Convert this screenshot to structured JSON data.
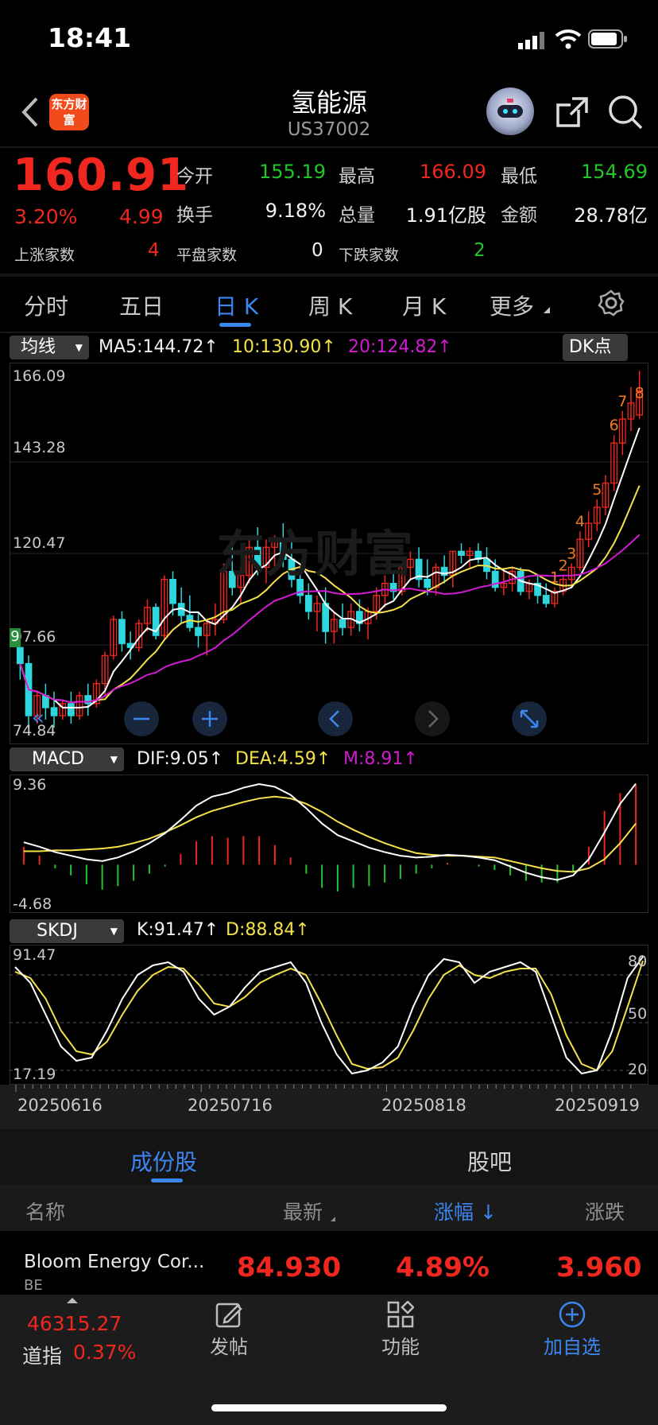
{
  "status_bar": {
    "time": "18:41"
  },
  "header": {
    "title": "氢能源",
    "code": "US37002",
    "brand": "东方财富"
  },
  "quote": {
    "price": "160.91",
    "change_pct": "3.20%",
    "change": "4.99",
    "open_label": "今开",
    "open": "155.19",
    "high_label": "最高",
    "high": "166.09",
    "low_label": "最低",
    "low": "154.69",
    "turnover_label": "换手",
    "turnover": "9.18%",
    "volume_label": "总量",
    "volume": "1.91亿股",
    "amount_label": "金额",
    "amount": "28.78亿",
    "rise_label": "上涨家数",
    "rise": "4",
    "flat_label": "平盘家数",
    "flat": "0",
    "fall_label": "下跌家数",
    "fall": "2"
  },
  "tabs": [
    "分时",
    "五日",
    "日 K",
    "周 K",
    "月 K",
    "更多"
  ],
  "active_tab": "日 K",
  "main_chart": {
    "indicator_button": "均线",
    "ma5": "MA5:144.72",
    "ma10": "10:130.90",
    "ma20": "20:124.82",
    "dk_button": "DK点",
    "y_ticks": [
      "166.09",
      "143.28",
      "120.47",
      "97.66",
      "74.84"
    ],
    "watermark": "东方财富",
    "signal_left": "9",
    "signals": [
      "1",
      "2",
      "3",
      "4",
      "5",
      "6",
      "7",
      "8"
    ]
  },
  "macd_chart": {
    "indicator_button": "MACD",
    "dif": "DIF:9.05",
    "dea": "DEA:4.59",
    "m": "M:8.91",
    "y_ticks": [
      "9.36",
      "-4.68"
    ]
  },
  "skdj_chart": {
    "indicator_button": "SKDJ",
    "k": "K:91.47",
    "d": "D:88.84",
    "y_ticks": [
      "91.47",
      "17.19"
    ],
    "right_ticks": [
      "80",
      "50",
      "20"
    ],
    "dates": [
      "20250616",
      "20250716",
      "20250818",
      "20250919"
    ]
  },
  "colors": {
    "up": "#f0271f",
    "down": "#22c52a",
    "accent": "#3c86f0",
    "ma5": "#ffffff",
    "ma10": "#f5e14a",
    "ma20": "#d21ad2",
    "candle_down": "#2fd6de"
  },
  "segment_tabs": [
    "成份股",
    "股吧"
  ],
  "table": {
    "headers": [
      "名称",
      "最新",
      "涨幅",
      "涨跌"
    ],
    "rows": [
      {
        "name": "Bloom Energy Cor...",
        "code": "BE",
        "last": "84.930",
        "pct": "4.89%",
        "chg": "3.960"
      }
    ]
  },
  "bottom_bar": {
    "index_value": "46315.27",
    "index_name": "道指",
    "index_pct": "0.37%",
    "items": [
      "发帖",
      "功能",
      "加自选"
    ]
  },
  "chart_data": [
    {
      "type": "candlestick",
      "title": "",
      "ylim": [
        74.84,
        166.09
      ],
      "xlim": [
        "20250616",
        "20250922"
      ],
      "x_ticks": [
        "20250616",
        "20250716",
        "20250818",
        "20250919"
      ],
      "ohlc": [
        [
          97,
          98,
          89,
          93
        ],
        [
          93,
          95,
          77,
          80
        ],
        [
          80,
          86,
          78,
          85
        ],
        [
          85,
          88,
          79,
          82
        ],
        [
          82,
          86,
          77,
          80
        ],
        [
          80,
          84,
          79,
          83
        ],
        [
          83,
          86,
          78,
          80
        ],
        [
          80,
          86,
          79,
          85
        ],
        [
          85,
          88,
          80,
          83
        ],
        [
          83,
          89,
          82,
          88
        ],
        [
          88,
          96,
          85,
          95
        ],
        [
          95,
          105,
          94,
          104
        ],
        [
          104,
          106,
          96,
          98
        ],
        [
          98,
          101,
          94,
          97
        ],
        [
          97,
          104,
          96,
          103
        ],
        [
          103,
          109,
          101,
          107
        ],
        [
          107,
          108,
          99,
          100
        ],
        [
          100,
          115,
          99,
          114
        ],
        [
          114,
          116,
          105,
          108
        ],
        [
          108,
          112,
          103,
          105
        ],
        [
          105,
          110,
          101,
          102
        ],
        [
          102,
          106,
          97,
          100
        ],
        [
          100,
          104,
          95,
          103
        ],
        [
          103,
          108,
          100,
          104
        ],
        [
          104,
          118,
          103,
          116
        ],
        [
          116,
          122,
          110,
          112
        ],
        [
          112,
          117,
          108,
          115
        ],
        [
          115,
          124,
          113,
          122
        ],
        [
          122,
          127,
          115,
          117
        ],
        [
          117,
          124,
          113,
          122
        ],
        [
          122,
          125,
          117,
          124
        ],
        [
          124,
          128,
          117,
          119
        ],
        [
          119,
          124,
          112,
          114
        ],
        [
          114,
          117,
          108,
          110
        ],
        [
          110,
          113,
          104,
          106
        ],
        [
          106,
          110,
          101,
          108
        ],
        [
          108,
          112,
          98,
          101
        ],
        [
          101,
          106,
          98,
          104
        ],
        [
          104,
          108,
          100,
          102
        ],
        [
          102,
          108,
          100,
          106
        ],
        [
          106,
          109,
          101,
          103
        ],
        [
          103,
          107,
          99,
          106
        ],
        [
          106,
          112,
          104,
          110
        ],
        [
          110,
          115,
          107,
          113
        ],
        [
          113,
          116,
          109,
          111
        ],
        [
          111,
          118,
          110,
          117
        ],
        [
          117,
          121,
          114,
          119
        ],
        [
          119,
          122,
          112,
          114
        ],
        [
          114,
          119,
          110,
          112
        ],
        [
          112,
          118,
          110,
          117
        ],
        [
          117,
          120,
          113,
          115
        ],
        [
          115,
          121,
          112,
          121
        ],
        [
          121,
          123,
          118,
          120
        ],
        [
          120,
          122,
          117,
          121
        ],
        [
          121,
          123,
          118,
          119
        ],
        [
          119,
          122,
          114,
          116
        ],
        [
          116,
          119,
          111,
          112
        ],
        [
          112,
          116,
          110,
          113
        ],
        [
          113,
          117,
          111,
          116
        ],
        [
          116,
          117,
          110,
          111
        ],
        [
          111,
          114,
          109,
          113
        ],
        [
          113,
          115,
          108,
          110
        ],
        [
          110,
          113,
          107,
          108
        ],
        [
          108,
          112,
          107,
          111
        ],
        [
          111,
          115,
          110,
          114
        ],
        [
          114,
          118,
          112,
          117
        ],
        [
          117,
          126,
          116,
          124
        ],
        [
          124,
          131,
          122,
          128
        ],
        [
          128,
          134,
          126,
          132
        ],
        [
          132,
          140,
          130,
          138
        ],
        [
          138,
          150,
          136,
          148
        ],
        [
          148,
          156,
          145,
          154
        ],
        [
          154,
          162,
          151,
          158
        ],
        [
          155,
          166,
          154,
          161
        ]
      ]
    },
    {
      "type": "line",
      "title": "MACD",
      "ylim": [
        -4.68,
        9.36
      ],
      "series": [
        {
          "name": "DIF",
          "values": [
            2.5,
            2.0,
            1.4,
            1.0,
            0.6,
            0.4,
            0.8,
            1.5,
            2.4,
            3.5,
            5.0,
            6.6,
            7.6,
            8.0,
            8.6,
            9.0,
            8.7,
            7.8,
            6.3,
            4.6,
            3.3,
            2.6,
            1.9,
            1.4,
            1.0,
            0.8,
            0.9,
            1.1,
            1.0,
            0.8,
            0.5,
            -0.2,
            -0.9,
            -1.4,
            -1.7,
            -1.2,
            0.6,
            3.6,
            6.8,
            9.05
          ]
        },
        {
          "name": "DEA",
          "values": [
            1.5,
            1.5,
            1.6,
            1.6,
            1.7,
            1.8,
            2.0,
            2.4,
            2.9,
            3.6,
            4.4,
            5.3,
            6.0,
            6.5,
            7.0,
            7.4,
            7.6,
            7.4,
            6.8,
            5.9,
            4.8,
            3.9,
            3.1,
            2.4,
            1.8,
            1.3,
            1.1,
            1.0,
            1.0,
            0.9,
            0.8,
            0.4,
            0.0,
            -0.4,
            -0.7,
            -0.8,
            -0.4,
            0.6,
            2.4,
            4.59
          ]
        },
        {
          "name": "M",
          "values": [
            2.0,
            1.0,
            -0.4,
            -1.2,
            -2.2,
            -2.8,
            -2.4,
            -1.8,
            -1.0,
            -0.2,
            1.2,
            2.6,
            3.2,
            3.0,
            3.2,
            3.2,
            2.2,
            0.8,
            -1.0,
            -2.6,
            -3.0,
            -2.6,
            -2.4,
            -2.0,
            -1.6,
            -1.0,
            -0.4,
            0.2,
            0.0,
            -0.2,
            -0.6,
            -1.2,
            -1.8,
            -2.0,
            -2.0,
            -0.8,
            2.0,
            6.0,
            8.0,
            8.91
          ]
        }
      ]
    },
    {
      "type": "line",
      "title": "SKDJ",
      "ylim": [
        17.19,
        91.47
      ],
      "series": [
        {
          "name": "K",
          "values": [
            85,
            75,
            55,
            35,
            26,
            28,
            45,
            65,
            80,
            86,
            88,
            82,
            65,
            55,
            60,
            72,
            82,
            85,
            88,
            75,
            50,
            30,
            18,
            20,
            25,
            35,
            60,
            80,
            90,
            88,
            75,
            82,
            85,
            88,
            82,
            55,
            28,
            18,
            20,
            45,
            78,
            91.47
          ]
        },
        {
          "name": "D",
          "values": [
            82,
            78,
            65,
            45,
            32,
            30,
            38,
            55,
            70,
            80,
            85,
            84,
            74,
            62,
            60,
            66,
            75,
            80,
            84,
            80,
            62,
            42,
            24,
            21,
            22,
            28,
            45,
            65,
            80,
            86,
            80,
            78,
            82,
            84,
            84,
            68,
            42,
            24,
            20,
            32,
            60,
            88.84
          ]
        }
      ]
    }
  ]
}
